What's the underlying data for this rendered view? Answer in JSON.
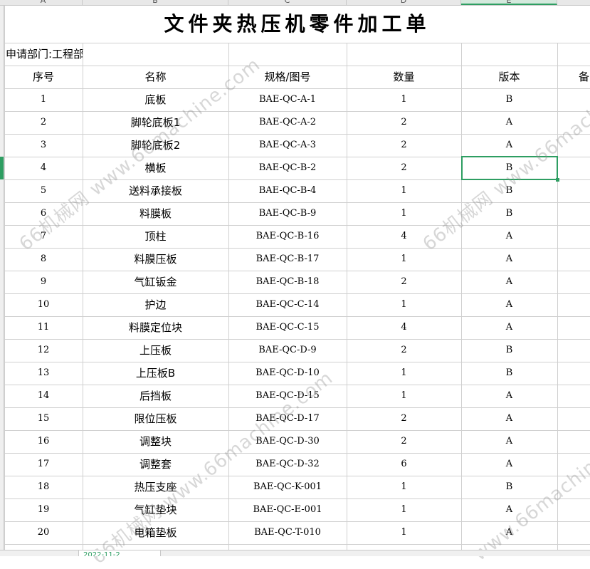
{
  "column_headers": [
    "A",
    "B",
    "C",
    "D",
    "E"
  ],
  "title": "文件夹热压机零件加工单",
  "department": "申请部门:工程部",
  "table": {
    "headers": [
      "序号",
      "名称",
      "规格/图号",
      "数量",
      "版本",
      "备"
    ],
    "rows": [
      [
        "1",
        "底板",
        "BAE-QC-A-1",
        "1",
        "B"
      ],
      [
        "2",
        "脚轮底板1",
        "BAE-QC-A-2",
        "2",
        "A"
      ],
      [
        "3",
        "脚轮底板2",
        "BAE-QC-A-3",
        "2",
        "A"
      ],
      [
        "4",
        "横板",
        "BAE-QC-B-2",
        "2",
        "B"
      ],
      [
        "5",
        "送料承接板",
        "BAE-QC-B-4",
        "1",
        "B"
      ],
      [
        "6",
        "料膜板",
        "BAE-QC-B-9",
        "1",
        "B"
      ],
      [
        "7",
        "顶柱",
        "BAE-QC-B-16",
        "4",
        "A"
      ],
      [
        "8",
        "料膜压板",
        "BAE-QC-B-17",
        "1",
        "A"
      ],
      [
        "9",
        "气缸钣金",
        "BAE-QC-B-18",
        "2",
        "A"
      ],
      [
        "10",
        "护边",
        "BAE-QC-C-14",
        "1",
        "A"
      ],
      [
        "11",
        "料膜定位块",
        "BAE-QC-C-15",
        "4",
        "A"
      ],
      [
        "12",
        "上压板",
        "BAE-QC-D-9",
        "2",
        "B"
      ],
      [
        "13",
        "上压板B",
        "BAE-QC-D-10",
        "1",
        "B"
      ],
      [
        "14",
        "后挡板",
        "BAE-QC-D-15",
        "1",
        "A"
      ],
      [
        "15",
        "限位压板",
        "BAE-QC-D-17",
        "2",
        "A"
      ],
      [
        "16",
        "调整块",
        "BAE-QC-D-30",
        "2",
        "A"
      ],
      [
        "17",
        "调整套",
        "BAE-QC-D-32",
        "6",
        "A"
      ],
      [
        "18",
        "热压支座",
        "BAE-QC-K-001",
        "1",
        "B"
      ],
      [
        "19",
        "气缸垫块",
        "BAE-QC-E-001",
        "1",
        "A"
      ],
      [
        "20",
        "电箱垫板",
        "BAE-QC-T-010",
        "1",
        "A"
      ]
    ]
  },
  "watermark_texts": [
    "66机械网 www.66machine.com",
    "66机械网 www.66machine.com",
    "66机械网 www.66machine.com",
    "www.66machine.com",
    "66machine.com"
  ],
  "sheet_tab": "2022-11-2",
  "colors": {
    "selection": "#2e9e62",
    "gridline": "#d0d0d0"
  }
}
